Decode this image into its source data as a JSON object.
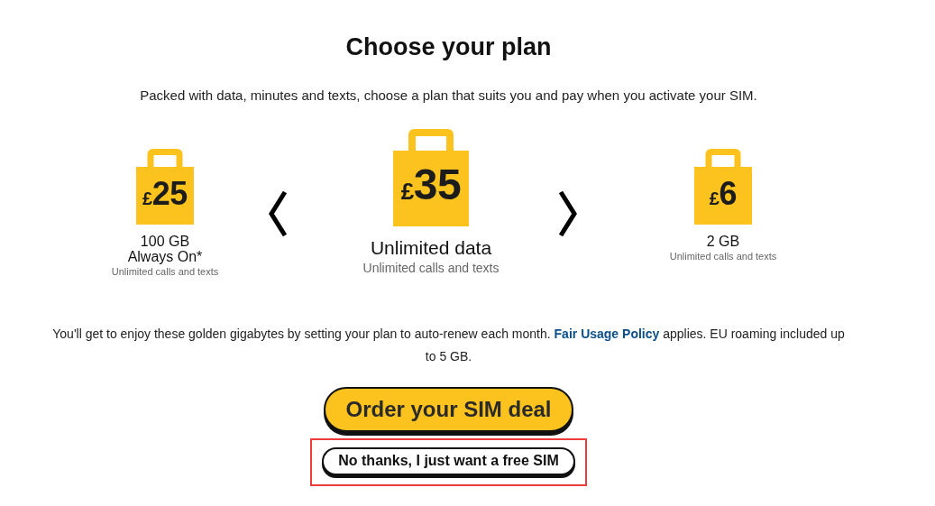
{
  "title": "Choose your plan",
  "subtitle": "Packed with data, minutes and texts, choose a plan that suits you and pay when you activate your SIM.",
  "plans": [
    {
      "currency": "£",
      "price": "25",
      "data_lines": [
        "100 GB",
        "Always On*"
      ],
      "extras": "Unlimited calls and texts",
      "selected": false
    },
    {
      "currency": "£",
      "price": "35",
      "data_lines": [
        "Unlimited data"
      ],
      "extras": "Unlimited calls and texts",
      "selected": true
    },
    {
      "currency": "£",
      "price": "6",
      "data_lines": [
        "2 GB"
      ],
      "extras": "Unlimited calls and texts",
      "selected": false
    }
  ],
  "note": {
    "before": "You'll get to enjoy these golden gigabytes by setting your plan to auto-renew each month.",
    "link": "Fair Usage Policy",
    "after": "applies. EU roaming included up to 5 GB."
  },
  "buttons": [
    {
      "label": "Order your SIM deal",
      "kind": "primary",
      "highlighted": false
    },
    {
      "label": "No thanks, I just want a free SIM",
      "kind": "secondary",
      "highlighted": true
    }
  ]
}
